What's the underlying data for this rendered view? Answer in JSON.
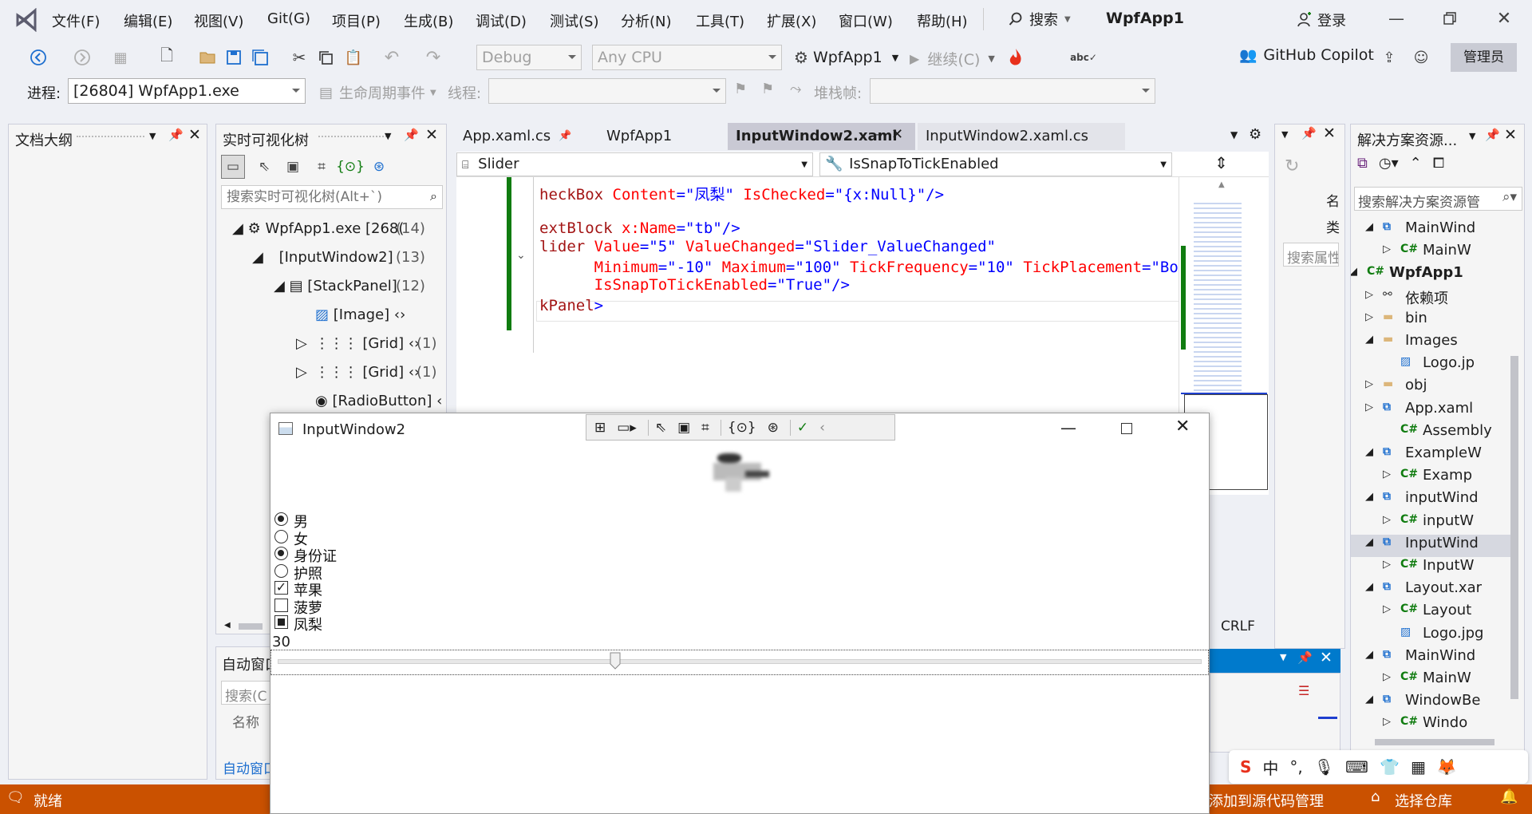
{
  "menubar": {
    "items": [
      "文件(F)",
      "编辑(E)",
      "视图(V)",
      "Git(G)",
      "项目(P)",
      "生成(B)",
      "调试(D)",
      "测试(S)",
      "分析(N)",
      "工具(T)",
      "扩展(X)",
      "窗口(W)",
      "帮助(H)"
    ],
    "search_label": "搜索",
    "solution_name": "WpfApp1",
    "login_label": "登录"
  },
  "toolbar": {
    "config": "Debug",
    "platform": "Any CPU",
    "startup_project": "WpfApp1",
    "continue_label": "继续(C)",
    "copilot_label": "GitHub Copilot",
    "admin_label": "管理员"
  },
  "debug_bar": {
    "process_label": "进程:",
    "process_value": "[26804] WpfApp1.exe",
    "lifecycle_label": "生命周期事件",
    "thread_label": "线程:",
    "stackframe_label": "堆栈帧:"
  },
  "outline_panel": {
    "title": "文档大纲"
  },
  "visual_tree": {
    "title": "实时可视化树",
    "search_placeholder": "搜索实时可视化树(Alt+`)",
    "nodes": [
      {
        "label": "WpfApp1.exe [268(",
        "count": "(14)"
      },
      {
        "label": "[InputWindow2]",
        "count": "(13)"
      },
      {
        "label": "[StackPanel]",
        "count": "(12)"
      },
      {
        "label": "[Image]",
        "count": ""
      },
      {
        "label": "[Grid]",
        "count": "(1)"
      },
      {
        "label": "[Grid]",
        "count": "(1)"
      },
      {
        "label": "[RadioButton]",
        "count": ""
      }
    ]
  },
  "auto_panel": {
    "title": "自动窗口",
    "search_placeholder": "搜索(C",
    "column_name": "名称",
    "footer_tab": "自动窗口"
  },
  "tabs": [
    {
      "label": "App.xaml.cs",
      "active": false
    },
    {
      "label": "WpfApp1",
      "active": false
    },
    {
      "label": "InputWindow2.xaml",
      "active": true
    },
    {
      "label": "InputWindow2.xaml.cs",
      "active": false
    }
  ],
  "nav_bar": {
    "element": "Slider",
    "member": "IsSnapToTickEnabled"
  },
  "code_lines": [
    {
      "parts": [
        [
          "k",
          "heckBox "
        ],
        [
          "a",
          "Content"
        ],
        [
          "v",
          "=\"凤梨\" "
        ],
        [
          "a",
          "IsChecked"
        ],
        [
          "v",
          "=\"{x:Null}\"/>"
        ]
      ]
    },
    {
      "parts": [
        [
          "k",
          "extBlock "
        ],
        [
          "a",
          "x:Name"
        ],
        [
          "v",
          "=\"tb\"/>"
        ]
      ]
    },
    {
      "parts": [
        [
          "k",
          "lider "
        ],
        [
          "a",
          "Value"
        ],
        [
          "v",
          "=\"5\" "
        ],
        [
          "a",
          "ValueChanged"
        ],
        [
          "v",
          "=\"Slider_ValueChanged\""
        ]
      ]
    },
    {
      "parts": [
        [
          "a",
          "      Minimum"
        ],
        [
          "v",
          "=\"-10\" "
        ],
        [
          "a",
          "Maximum"
        ],
        [
          "v",
          "=\"100\" "
        ],
        [
          "a",
          "TickFrequency"
        ],
        [
          "v",
          "=\"10\" "
        ],
        [
          "a",
          "TickPlacement"
        ],
        [
          "v",
          "=\"Botto"
        ]
      ]
    },
    {
      "parts": [
        [
          "a",
          "      IsSnapToTickEnabled"
        ],
        [
          "v",
          "=\"True\"/>"
        ]
      ]
    },
    {
      "parts": [
        [
          "k",
          "kPanel"
        ],
        [
          "v",
          ">"
        ]
      ]
    }
  ],
  "editor_status": {
    "line_ending": "CRLF"
  },
  "props_panel": {
    "search_placeholder": "搜索属性",
    "side_chars": [
      "名",
      "类"
    ]
  },
  "solution_explorer": {
    "title": "解决方案资源...",
    "search_placeholder": "搜索解决方案资源管",
    "items": [
      {
        "label": "MainWind",
        "icon": "xaml-file-icon"
      },
      {
        "label": "MainW",
        "icon": "csharp-file-icon"
      },
      {
        "label": "WpfApp1",
        "icon": "csharp-project-icon"
      },
      {
        "label": "依赖项",
        "icon": "dependencies-icon"
      },
      {
        "label": "bin",
        "icon": "folder-icon"
      },
      {
        "label": "Images",
        "icon": "folder-icon"
      },
      {
        "label": "Logo.jp",
        "icon": "image-file-icon"
      },
      {
        "label": "obj",
        "icon": "folder-icon"
      },
      {
        "label": "App.xaml",
        "icon": "xaml-file-icon"
      },
      {
        "label": "Assembly",
        "icon": "csharp-file-icon"
      },
      {
        "label": "ExampleW",
        "icon": "xaml-file-icon"
      },
      {
        "label": "Examp",
        "icon": "csharp-file-icon"
      },
      {
        "label": "inputWind",
        "icon": "xaml-file-icon"
      },
      {
        "label": "inputW",
        "icon": "csharp-file-icon"
      },
      {
        "label": "InputWind",
        "icon": "xaml-file-icon"
      },
      {
        "label": "InputW",
        "icon": "csharp-file-icon"
      },
      {
        "label": "Layout.xar",
        "icon": "xaml-file-icon"
      },
      {
        "label": "Layout",
        "icon": "csharp-file-icon"
      },
      {
        "label": "Logo.jpg",
        "icon": "image-file-icon"
      },
      {
        "label": "MainWind",
        "icon": "xaml-file-icon"
      },
      {
        "label": "MainW",
        "icon": "csharp-file-icon"
      },
      {
        "label": "WindowBe",
        "icon": "xaml-file-icon"
      },
      {
        "label": "Windo",
        "icon": "csharp-file-icon"
      }
    ]
  },
  "app_window": {
    "title": "InputWindow2",
    "options": [
      {
        "label": "男",
        "type": "radio",
        "checked": true
      },
      {
        "label": "女",
        "type": "radio",
        "checked": false
      },
      {
        "label": "身份证",
        "type": "radio",
        "checked": true
      },
      {
        "label": "护照",
        "type": "radio",
        "checked": false
      },
      {
        "label": "苹果",
        "type": "checkbox",
        "state": "checked"
      },
      {
        "label": "菠萝",
        "type": "checkbox",
        "state": "unchecked"
      },
      {
        "label": "凤梨",
        "type": "checkbox",
        "state": "indeterminate"
      }
    ],
    "value_text": "30",
    "slider": {
      "value": 30,
      "min": -10,
      "max": 100
    }
  },
  "ime_bar": {
    "lang": "中"
  },
  "statusbar": {
    "ready": "就绪",
    "add_source_control": "添加到源代码管理",
    "select_repo": "选择仓库"
  },
  "colors": {
    "accent": "#007acc",
    "status": "#ca5100",
    "admin_bg": "#c9cbd4",
    "active_tab": "#c9c9d4"
  }
}
